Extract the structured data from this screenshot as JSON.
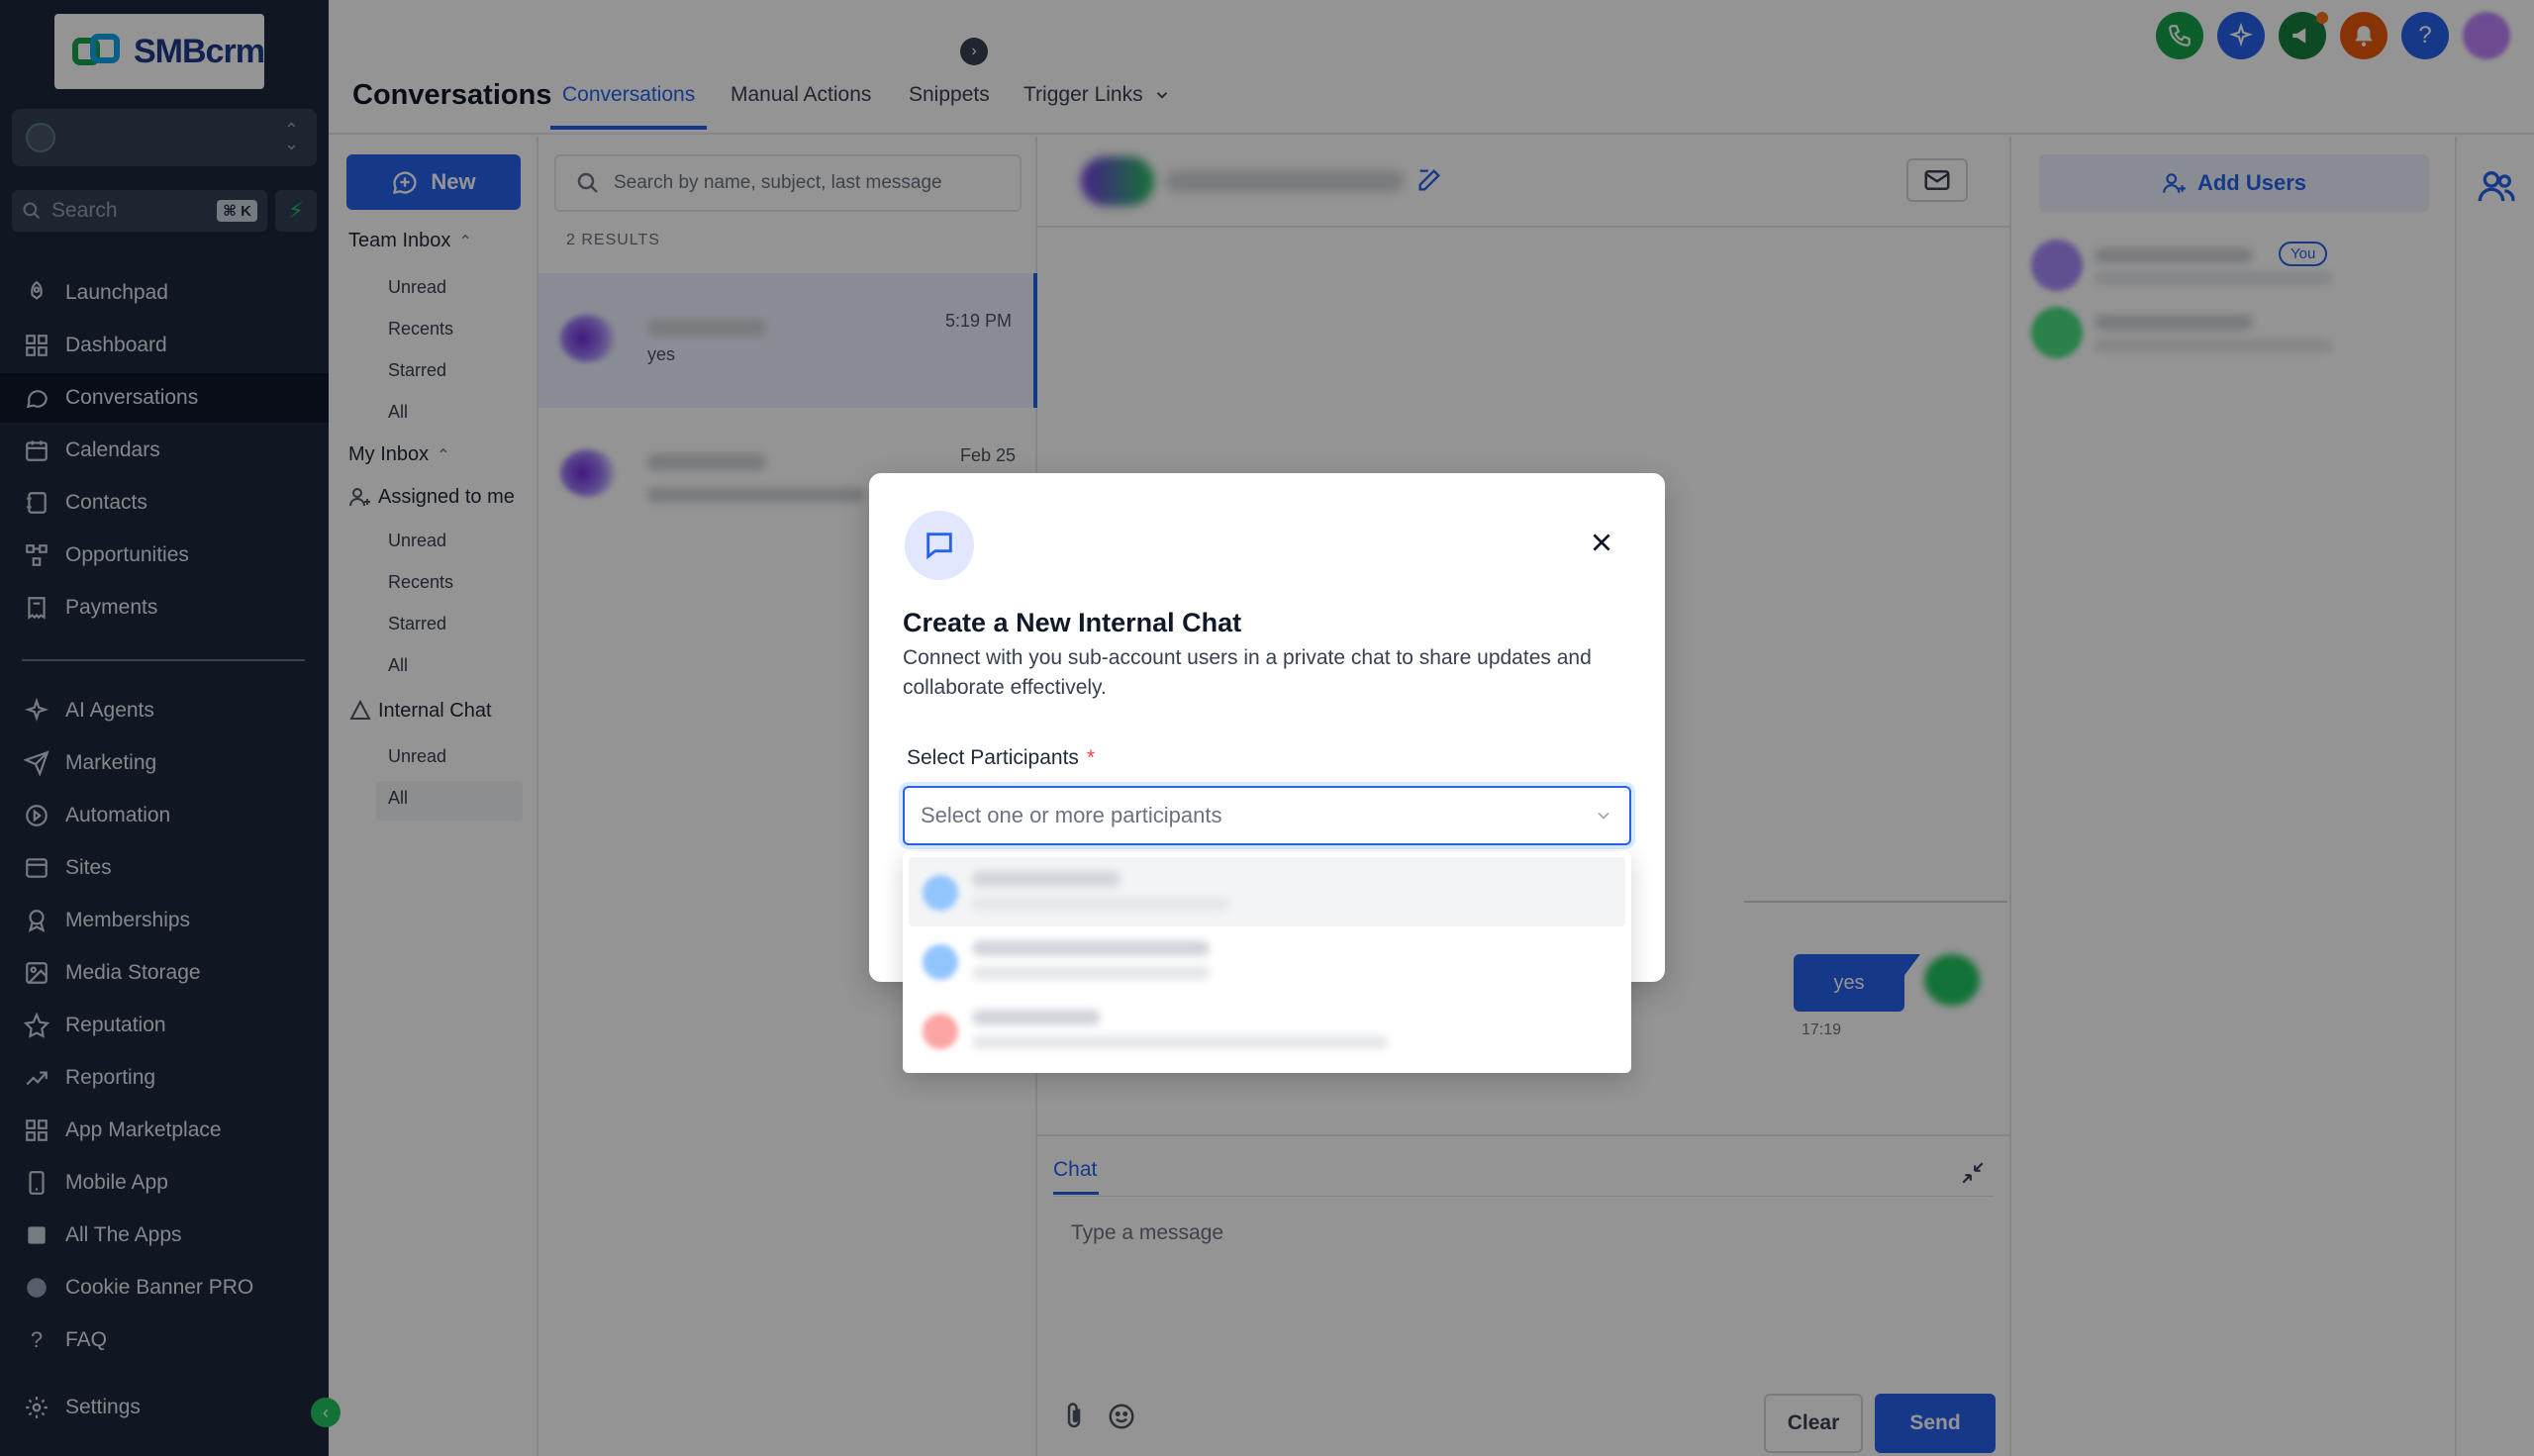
{
  "app": {
    "logo_text": "SMBcrm"
  },
  "sidebar": {
    "search_placeholder": "Search",
    "search_shortcut": "⌘ K",
    "items": [
      {
        "label": "Launchpad",
        "icon": "rocket-icon"
      },
      {
        "label": "Dashboard",
        "icon": "grid-icon"
      },
      {
        "label": "Conversations",
        "icon": "chat-bubble-icon",
        "active": true
      },
      {
        "label": "Calendars",
        "icon": "calendar-icon"
      },
      {
        "label": "Contacts",
        "icon": "contacts-icon"
      },
      {
        "label": "Opportunities",
        "icon": "pipeline-icon"
      },
      {
        "label": "Payments",
        "icon": "receipt-icon"
      },
      {
        "label": "AI Agents",
        "icon": "sparkles-icon"
      },
      {
        "label": "Marketing",
        "icon": "send-icon"
      },
      {
        "label": "Automation",
        "icon": "automation-icon"
      },
      {
        "label": "Sites",
        "icon": "sites-icon"
      },
      {
        "label": "Memberships",
        "icon": "badge-icon"
      },
      {
        "label": "Media Storage",
        "icon": "image-icon"
      },
      {
        "label": "Reputation",
        "icon": "star-icon"
      },
      {
        "label": "Reporting",
        "icon": "trend-icon"
      },
      {
        "label": "App Marketplace",
        "icon": "apps-icon"
      },
      {
        "label": "Mobile App",
        "icon": "mobile-icon"
      },
      {
        "label": "All The Apps",
        "icon": "apps-square-icon"
      },
      {
        "label": "Cookie Banner PRO",
        "icon": "cookie-icon"
      },
      {
        "label": "FAQ",
        "icon": "question-icon"
      }
    ],
    "settings_label": "Settings"
  },
  "header": {
    "title": "Conversations",
    "tabs": [
      "Conversations",
      "Manual Actions",
      "Snippets",
      "Trigger Links"
    ]
  },
  "filters": {
    "new_label": "New",
    "team_inbox": "Team Inbox",
    "team_items": [
      "Unread",
      "Recents",
      "Starred",
      "All"
    ],
    "my_inbox": "My Inbox",
    "assigned_to_me": "Assigned to me",
    "my_items": [
      "Unread",
      "Recents",
      "Starred",
      "All"
    ],
    "internal_chat": "Internal Chat",
    "internal_items": [
      "Unread",
      "All"
    ]
  },
  "list": {
    "search_placeholder": "Search by name, subject, last message",
    "results": "2 RESULTS",
    "conversations": [
      {
        "time": "5:19 PM",
        "preview": "yes"
      },
      {
        "time": "Feb 25",
        "preview": ""
      }
    ]
  },
  "chat": {
    "bubble_text": "yes",
    "bubble_time": "17:19",
    "composer_tab": "Chat",
    "composer_placeholder": "Type a message",
    "clear_label": "Clear",
    "send_label": "Send"
  },
  "users": {
    "add_users_label": "Add Users",
    "you_badge": "You"
  },
  "modal": {
    "title": "Create a New Internal Chat",
    "description": "Connect with you sub-account users in a private chat to share updates and collaborate effectively.",
    "field_label": "Select Participants",
    "required_mark": "*",
    "select_placeholder": "Select one or more participants"
  },
  "colors": {
    "primary": "#2563eb",
    "sidebar_bg": "#1e293b",
    "accent_green": "#22c55e"
  }
}
